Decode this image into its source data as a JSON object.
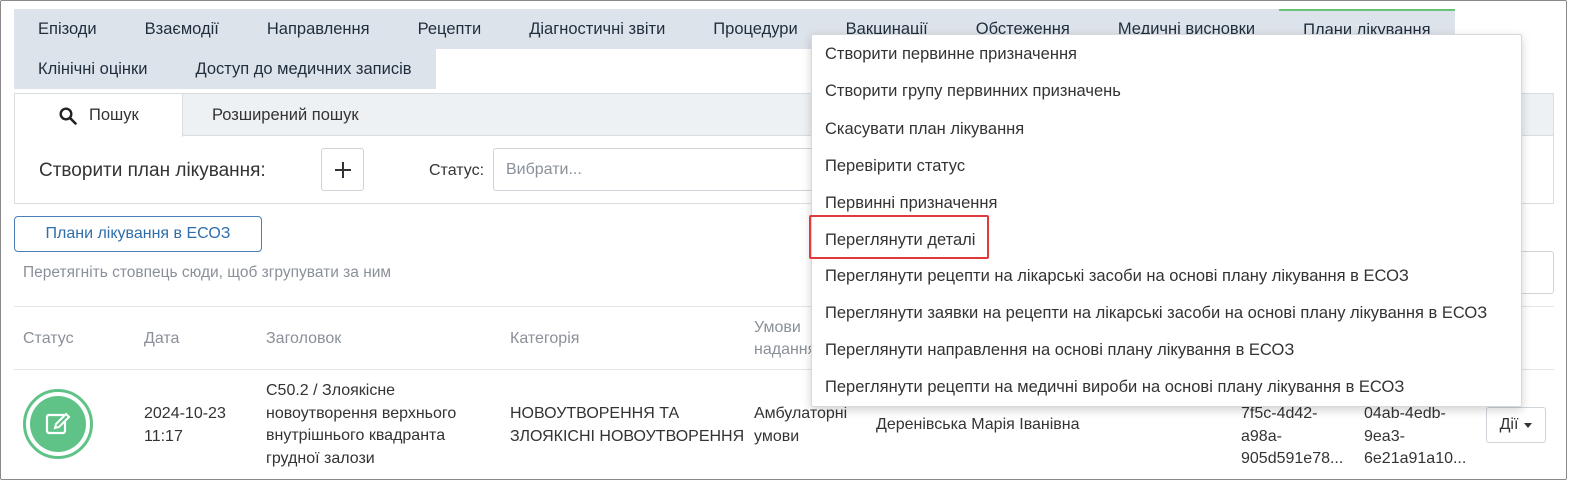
{
  "tabs_row1": [
    "Епізоди",
    "Взаємодії",
    "Направлення",
    "Рецепти",
    "Діагностичні звіти",
    "Процедури",
    "Вакцинації",
    "Обстеження",
    "Медичні висновки",
    "Плани лікування"
  ],
  "tabs_row2": [
    "Клінічні оцінки",
    "Доступ до медичних записів"
  ],
  "subtabs": {
    "search": "Пошук",
    "advanced": "Розширений пошук"
  },
  "search_panel": {
    "create_label": "Створити план лікування:",
    "status_label": "Статус:",
    "status_placeholder": "Вибрати..."
  },
  "ehealth_button": "Плани лікування в ЕСОЗ",
  "group_hint": "Перетягніть стовпець сюди, щоб згрупувати за ним",
  "table": {
    "headers": {
      "status": "Статус",
      "date": "Дата",
      "title": "Заголовок",
      "category": "Категорія",
      "conditions_1": "Умови",
      "conditions_2": "надання"
    },
    "row": {
      "date_1": "2024-10-23",
      "date_2": "11:17",
      "title_1": "C50.2 / Злоякісне",
      "title_2": "новоутворення верхнього",
      "title_3": "внутрішнього квадранта",
      "title_4": "грудної залози",
      "category_1": "НОВОУТВОРЕННЯ ТА",
      "category_2": "ЗЛОЯКІСНІ НОВОУТВОРЕННЯ",
      "conditions_1": "Амбулаторні",
      "conditions_2": "умови",
      "doctor": "Деренівська Марія Іванівна",
      "id1_1": "7f5c-4d42-",
      "id1_2": "a98a-",
      "id1_3": "905d591e78...",
      "id2_1": "04ab-4edb-",
      "id2_2": "9ea3-",
      "id2_3": "6e21a91a10...",
      "actions": "Дії"
    }
  },
  "menu": [
    "Створити первинне призначення",
    "Створити групу первинних призначень",
    "Скасувати план лікування",
    "Перевірити статус",
    "Первинні призначення",
    "Переглянути деталі",
    "Переглянути рецепти на лікарські засоби на основі плану лікування в ЕСОЗ",
    "Переглянути заявки на рецепти на лікарські засоби на основі плану лікування в ЕСОЗ",
    "Переглянути направлення на основі плану лікування в ЕСОЗ",
    "Переглянути рецепти на медичні вироби на основі плану лікування в ЕСОЗ"
  ],
  "colors": {
    "accent": "#6bc27a",
    "tab_bg": "#dde3ea",
    "highlight": "#e03a3a",
    "link": "#2f6ea8",
    "status_green": "#5fc388"
  }
}
